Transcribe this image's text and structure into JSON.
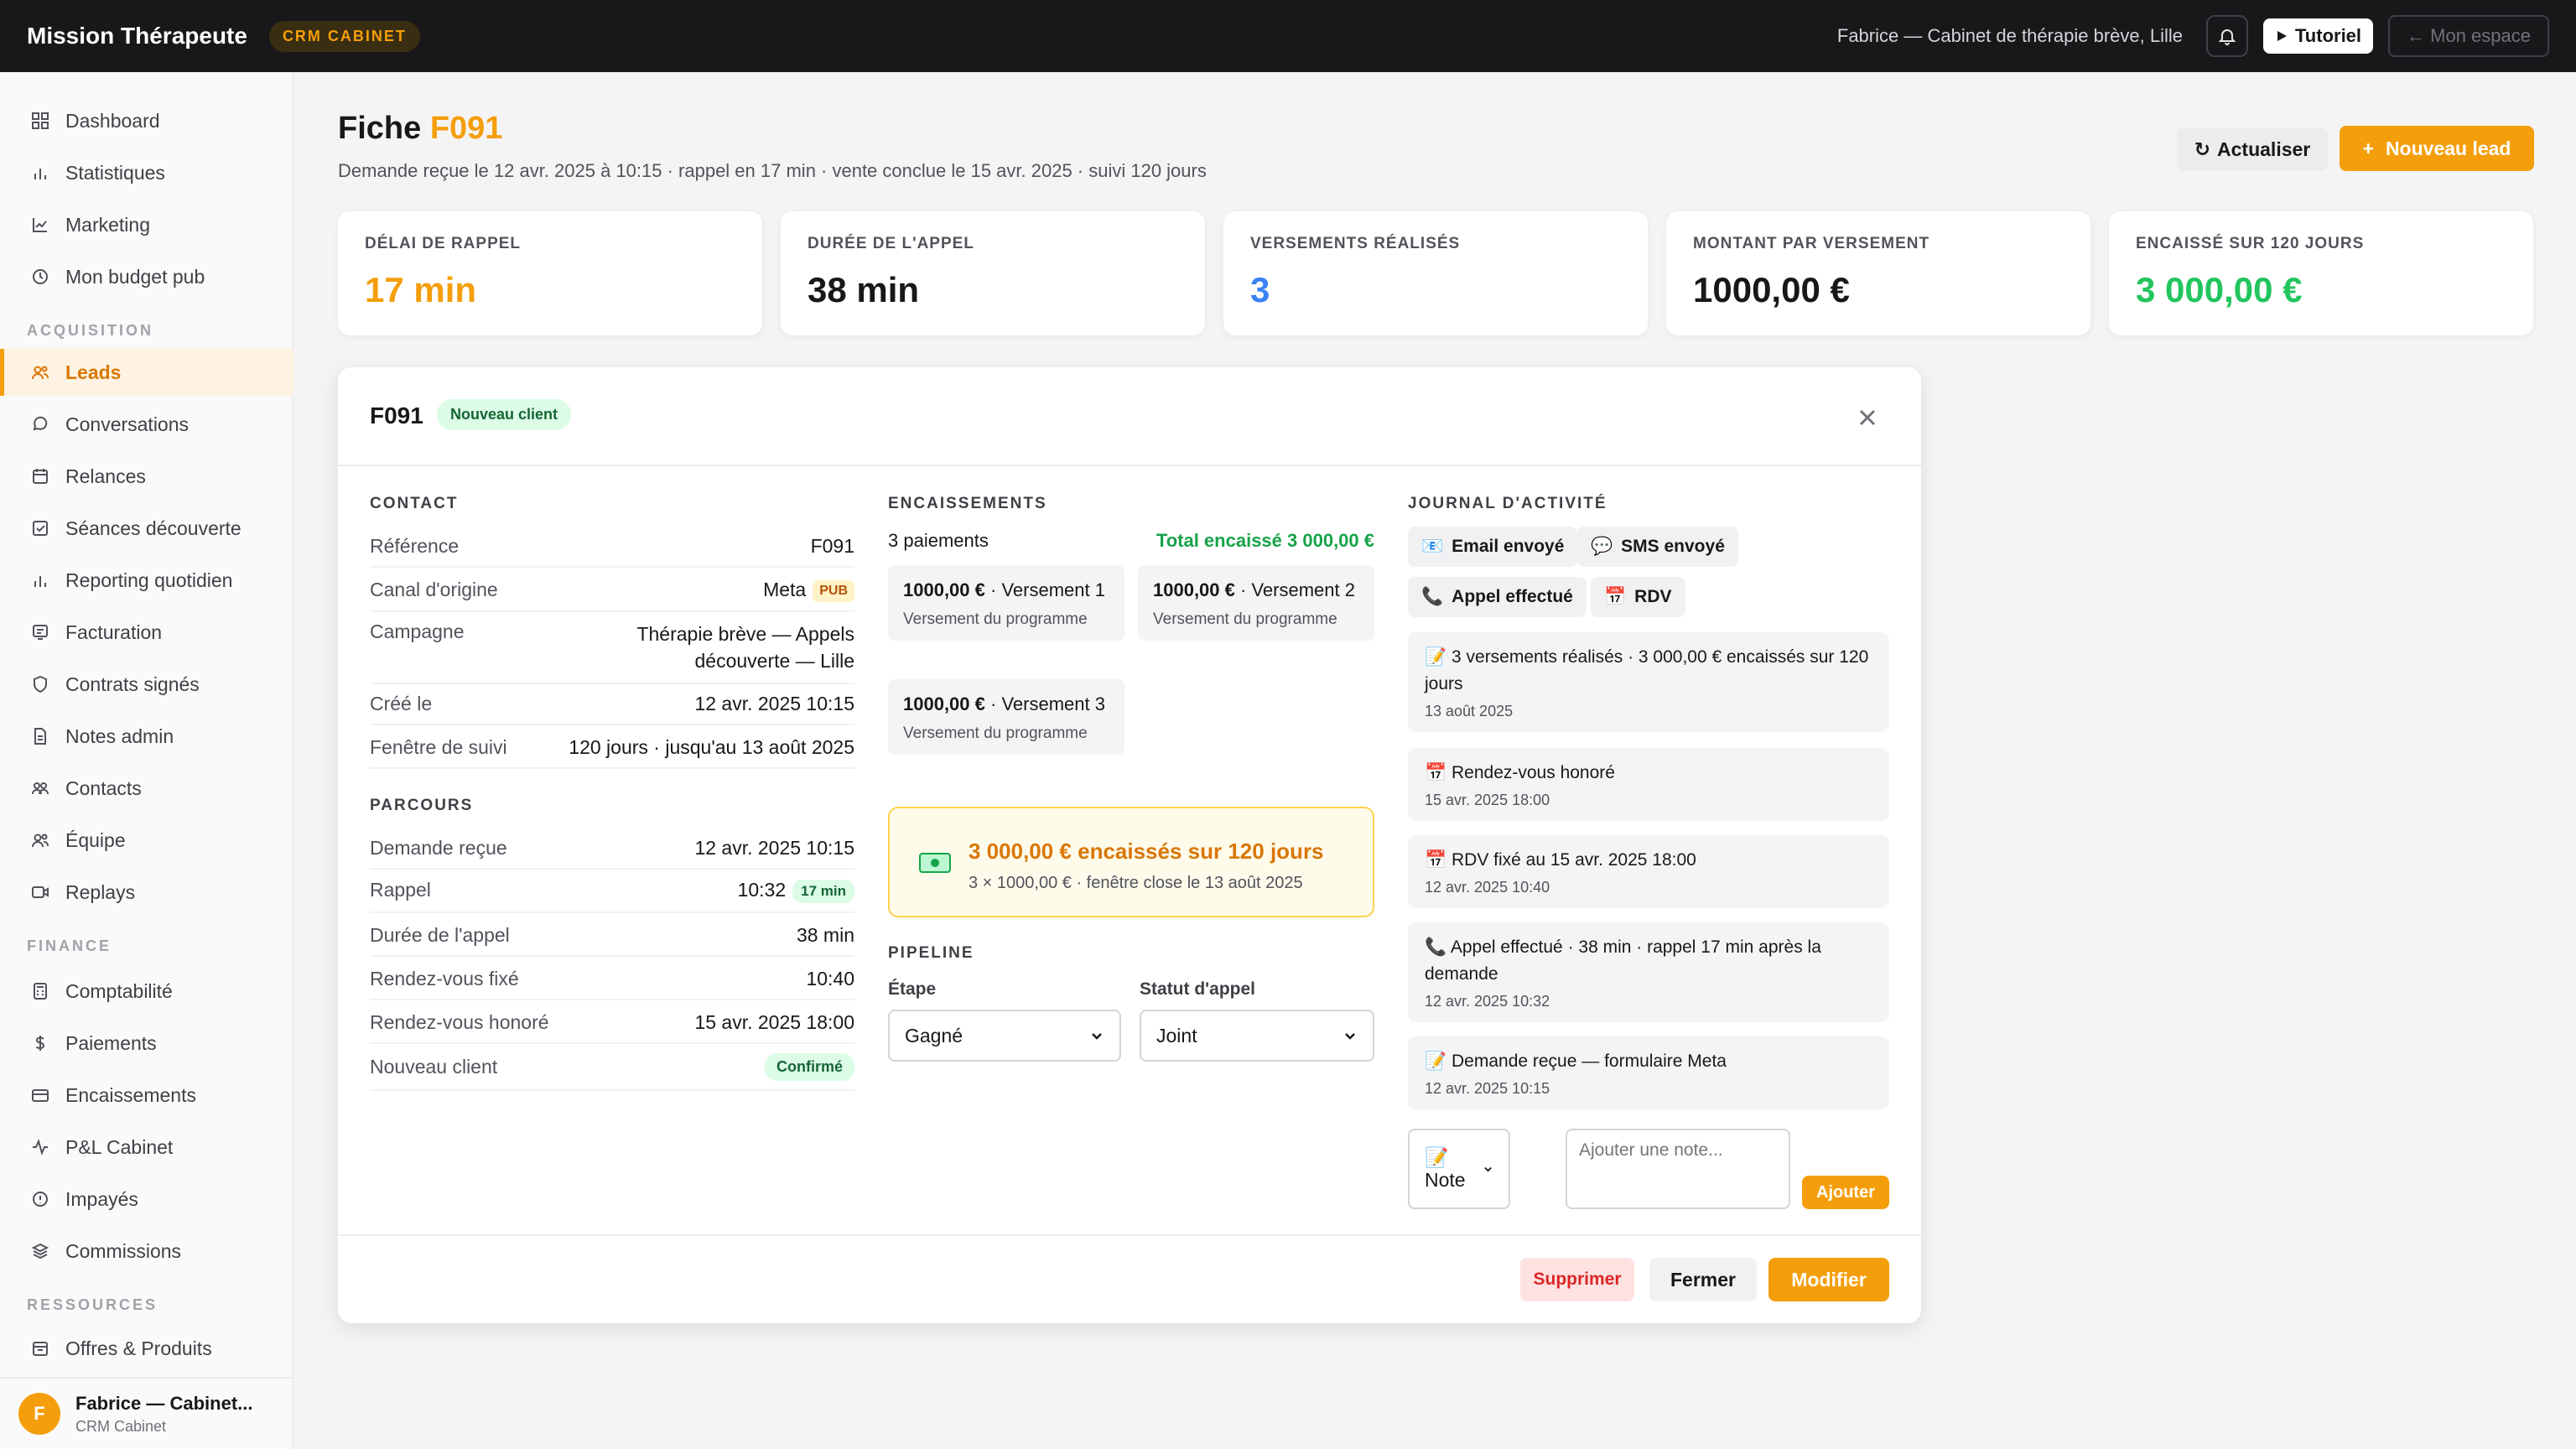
{
  "topbar": {
    "brand": "Mission Thérapeute",
    "badge": "CRM CABINET",
    "user": "Fabrice — Cabinet de thérapie brève, Lille",
    "tutorial_label": "Tutoriel",
    "space_label": "← Mon espace",
    "bell_icon": "bell-icon"
  },
  "sidebar": {
    "items_top": [
      {
        "label": "Dashboard",
        "icon": "grid-icon"
      },
      {
        "label": "Statistiques",
        "icon": "bar-chart-icon"
      },
      {
        "label": "Marketing",
        "icon": "line-chart-icon"
      },
      {
        "label": "Mon budget pub",
        "icon": "clock-icon"
      }
    ],
    "section_acquisition": "ACQUISITION",
    "items_acquisition": [
      {
        "label": "Leads",
        "icon": "users-icon"
      },
      {
        "label": "Conversations",
        "icon": "chat-icon"
      },
      {
        "label": "Relances",
        "icon": "calendar-icon"
      },
      {
        "label": "Séances découverte",
        "icon": "check-square-icon"
      },
      {
        "label": "Reporting quotidien",
        "icon": "bar-chart-icon"
      },
      {
        "label": "Facturation",
        "icon": "receipt-icon"
      },
      {
        "label": "Contrats signés",
        "icon": "shield-icon"
      },
      {
        "label": "Notes admin",
        "icon": "document-icon"
      },
      {
        "label": "Contacts",
        "icon": "contacts-icon"
      },
      {
        "label": "Équipe",
        "icon": "team-icon"
      },
      {
        "label": "Replays",
        "icon": "video-icon"
      }
    ],
    "section_finance": "FINANCE",
    "items_finance": [
      {
        "label": "Comptabilité",
        "icon": "calculator-icon"
      },
      {
        "label": "Paiements",
        "icon": "dollar-icon"
      },
      {
        "label": "Encaissements",
        "icon": "card-icon"
      },
      {
        "label": "P&L Cabinet",
        "icon": "pulse-icon"
      },
      {
        "label": "Impayés",
        "icon": "alert-circle-icon"
      },
      {
        "label": "Commissions",
        "icon": "layers-icon"
      }
    ],
    "section_resources": "RESSOURCES",
    "items_resources": [
      {
        "label": "Offres & Produits",
        "icon": "package-icon"
      }
    ],
    "footer": {
      "initial": "F",
      "name": "Fabrice — Cabinet...",
      "sub": "CRM Cabinet"
    }
  },
  "header": {
    "title_prefix": "Fiche",
    "title_ref": "F091",
    "subtitle": "Demande reçue le 12 avr. 2025 à 10:15 · rappel en 17 min · vente conclue le 15 avr. 2025 · suivi 120 jours",
    "refresh_label": "Actualiser",
    "new_lead_label": "Nouveau lead"
  },
  "kpis": [
    {
      "label": "DÉLAI DE RAPPEL",
      "value": "17 min",
      "color": "#f59e0b"
    },
    {
      "label": "DURÉE DE L'APPEL",
      "value": "38 min",
      "color": "#18181b"
    },
    {
      "label": "VERSEMENTS RÉALISÉS",
      "value": "3",
      "color": "#3b82f6"
    },
    {
      "label": "MONTANT PAR VERSEMENT",
      "value": "1000,00 €",
      "color": "#18181b"
    },
    {
      "label": "ENCAISSÉ SUR 120 JOURS",
      "value": "3 000,00 €",
      "color": "#22c55e"
    }
  ],
  "modal": {
    "title": "F091",
    "badge": "Nouveau client",
    "contact": {
      "title": "CONTACT",
      "rows": [
        {
          "k": "Référence",
          "v": "F091"
        },
        {
          "k": "Canal d'origine",
          "v": "Meta",
          "tag": "PUB"
        },
        {
          "k": "Campagne",
          "v": "Thérapie brève — Appels découverte — Lille"
        },
        {
          "k": "Créé le",
          "v": "12 avr. 2025 10:15"
        },
        {
          "k": "Fenêtre de suivi",
          "v": "120 jours · jusqu'au 13 août 2025"
        }
      ]
    },
    "parcours": {
      "title": "PARCOURS",
      "rows": [
        {
          "k": "Demande reçue",
          "v": "12 avr. 2025 10:15"
        },
        {
          "k": "Rappel",
          "v": "10:32",
          "tag": "17 min"
        },
        {
          "k": "Durée de l'appel",
          "v": "38 min"
        },
        {
          "k": "Rendez-vous fixé",
          "v": "10:40"
        },
        {
          "k": "Rendez-vous honoré",
          "v": "15 avr. 2025 18:00"
        },
        {
          "k": "Nouveau client",
          "v": "Confirmé"
        }
      ]
    },
    "encaissements": {
      "title": "ENCAISSEMENTS",
      "count": "3 paiements",
      "total": "Total encaissé 3 000,00 €",
      "payments": [
        {
          "amount": "1000,00 €",
          "label": "· Versement 1",
          "sub": "Versement du programme"
        },
        {
          "amount": "1000,00 €",
          "label": "· Versement 2",
          "sub": "Versement du programme"
        },
        {
          "amount": "1000,00 €",
          "label": "· Versement 3",
          "sub": "Versement du programme"
        }
      ],
      "banner_main": "3 000,00 € encaissés sur 120 jours",
      "banner_sub": "3 × 1000,00 € · fenêtre close le 13 août 2025"
    },
    "pipeline": {
      "title": "PIPELINE",
      "stage_label": "Étape",
      "stage_value": "Gagné",
      "status_label": "Statut d'appel",
      "status_value": "Joint"
    },
    "journal": {
      "title": "JOURNAL D'ACTIVITÉ",
      "actions": [
        {
          "label": "Email envoyé",
          "icon": "email-icon"
        },
        {
          "label": "SMS envoyé",
          "icon": "speech-bubble-icon"
        },
        {
          "label": "Appel effectué",
          "icon": "phone-icon"
        },
        {
          "label": "RDV",
          "icon": "calendar-icon"
        }
      ],
      "entries": [
        {
          "text": "3 versements réalisés · 3 000,00 € encaissés sur 120 jours",
          "date": "13 août 2025",
          "icon": "memo-icon"
        },
        {
          "text": "Rendez-vous honoré",
          "date": "15 avr. 2025 18:00",
          "icon": "calendar-icon"
        },
        {
          "text": "RDV fixé au 15 avr. 2025 18:00",
          "date": "12 avr. 2025 10:40",
          "icon": "calendar-icon"
        },
        {
          "text": "Appel effectué · 38 min · rappel 17 min après la demande",
          "date": "12 avr. 2025 10:32",
          "icon": "phone-icon"
        },
        {
          "text": "Demande reçue — formulaire Meta",
          "date": "12 avr. 2025 10:15",
          "icon": "memo-icon"
        }
      ],
      "note_type": "Note",
      "note_placeholder": "Ajouter une note...",
      "add_label": "Ajouter"
    },
    "footer": {
      "delete": "Supprimer",
      "close": "Fermer",
      "edit": "Modifier"
    }
  }
}
